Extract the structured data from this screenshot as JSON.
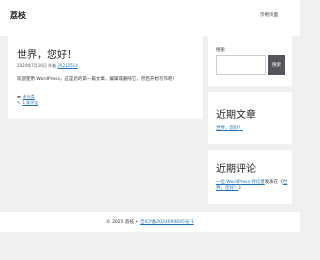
{
  "header": {
    "site_title": "荔枝",
    "nav_link": "示例页面"
  },
  "post": {
    "title": "世界，您好！",
    "date": "2024年7月16日",
    "by": "作者",
    "author": "20212514",
    "body": "欢迎使用 WordPress。这是您的第一篇文章。编辑或删除它，然后开始写作吧！",
    "category": "未分类",
    "comments": "1 条评论"
  },
  "sidebar": {
    "search_label": "搜索",
    "search_button": "搜索",
    "recent_posts_title": "近期文章",
    "recent_posts": [
      "世界，您好！"
    ],
    "recent_comments_title": "近期评论",
    "recent_comment": {
      "author": "一位 WordPress 评论者",
      "connector": "发表在《",
      "post": "世界，您好！",
      "end": "》"
    }
  },
  "footer": {
    "copyright": "© 2025 荔枝 •",
    "icp": "吉ICP备2024099695号-1"
  }
}
